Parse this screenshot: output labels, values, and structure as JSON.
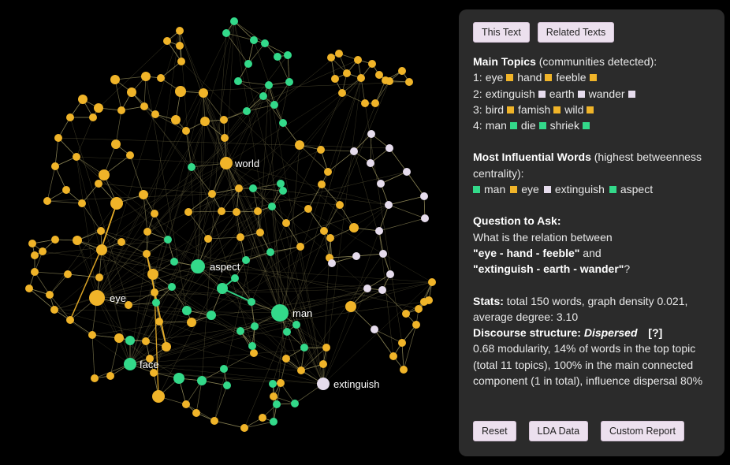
{
  "graph": {
    "colors": {
      "orange": "#f0b429",
      "green": "#33d98a",
      "white": "#e6dced",
      "edge": "#8e8757"
    },
    "labels": {
      "world": "world",
      "aspect": "aspect",
      "eye": "eye",
      "man": "man",
      "face": "face",
      "extinguish": "extinguish"
    }
  },
  "controls": {
    "zoom_in": "+",
    "zoom_out": "−",
    "pen": "✎"
  },
  "panel": {
    "btn_this_text": "This Text",
    "btn_related_texts": "Related Texts",
    "main_topics_title": "Main Topics",
    "main_topics_note": "(communities detected):",
    "topics": [
      {
        "n": "1:",
        "w": [
          "eye",
          "hand",
          "feeble"
        ],
        "color": "orange"
      },
      {
        "n": "2:",
        "w": [
          "extinguish",
          "earth",
          "wander"
        ],
        "color": "white"
      },
      {
        "n": "3:",
        "w": [
          "bird",
          "famish",
          "wild"
        ],
        "color": "orange"
      },
      {
        "n": "4:",
        "w": [
          "man",
          "die",
          "shriek"
        ],
        "color": "green"
      }
    ],
    "influential_title": "Most Influential Words",
    "influential_note": "(highest betweenness centrality):",
    "influential": [
      {
        "w": "man",
        "color": "green"
      },
      {
        "w": "eye",
        "color": "orange"
      },
      {
        "w": "extinguish",
        "color": "white"
      },
      {
        "w": "aspect",
        "color": "green"
      }
    ],
    "question_title": "Question to Ask:",
    "question_line1": "What is the relation between",
    "question_q1": "\"eye - hand - feeble\"",
    "question_and": " and",
    "question_q2": "\"extinguish - earth - wander\"",
    "question_end": "?",
    "stats_title": "Stats:",
    "stats_text": "total 150 words, graph density 0.021, average degree: 3.10",
    "discourse_title": "Discourse structure:",
    "discourse_value": "Dispersed",
    "discourse_help": "[?]",
    "discourse_text": "0.68 modularity, 14% of words in the top topic (total 11 topics), 100% in the main connected component (1 in total), influence dispersal 80%",
    "btn_reset": "Reset",
    "btn_lda": "LDA Data",
    "btn_custom": "Custom Report"
  }
}
